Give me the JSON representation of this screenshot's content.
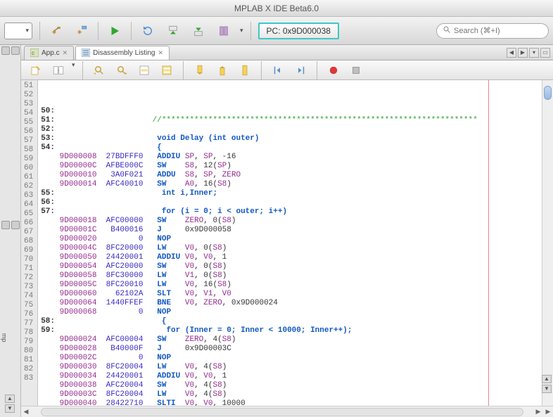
{
  "window": {
    "title": "MPLAB X IDE Beta6.0"
  },
  "toolbar": {
    "pc": "PC: 0x9D000038",
    "searchPlaceholder": "Search (⌘+I)"
  },
  "tabs": [
    {
      "label": "App.c",
      "active": false
    },
    {
      "label": "Disassembly Listing",
      "active": true
    }
  ],
  "disassembly": {
    "startLine": 51,
    "rows": [
      {
        "srcnum": "50:",
        "addr": "",
        "hex": "",
        "code": ""
      },
      {
        "srcnum": "51:",
        "addr": "",
        "hex": "",
        "code": "",
        "comment": "//********************************************************************"
      },
      {
        "srcnum": "52:",
        "addr": "",
        "hex": "",
        "code": ""
      },
      {
        "srcnum": "53:",
        "addr": "",
        "hex": "",
        "src": "void Delay (int outer)"
      },
      {
        "srcnum": "54:",
        "addr": "",
        "hex": "",
        "src": "{"
      },
      {
        "srcnum": "",
        "addr": "9D000008",
        "hex": "27BDFFF0",
        "mnem": "ADDIU",
        "ops": "SP, SP, -16"
      },
      {
        "srcnum": "",
        "addr": "9D00000C",
        "hex": "AFBE000C",
        "mnem": "SW",
        "ops": "S8, 12(SP)"
      },
      {
        "srcnum": "",
        "addr": "9D000010",
        "hex": "3A0F021",
        "mnem": "ADDU",
        "ops": "S8, SP, ZERO"
      },
      {
        "srcnum": "",
        "addr": "9D000014",
        "hex": "AFC40010",
        "mnem": "SW",
        "ops": "A0, 16(S8)"
      },
      {
        "srcnum": "55:",
        "addr": "",
        "hex": "",
        "src": " int i,Inner;"
      },
      {
        "srcnum": "56:",
        "addr": "",
        "hex": "",
        "code": ""
      },
      {
        "srcnum": "57:",
        "addr": "",
        "hex": "",
        "src": " for (i = 0; i < outer; i++)"
      },
      {
        "srcnum": "",
        "addr": "9D000018",
        "hex": "AFC00000",
        "mnem": "SW",
        "ops": "ZERO, 0(S8)"
      },
      {
        "srcnum": "",
        "addr": "9D00001C",
        "hex": "B400016",
        "mnem": "J",
        "ops": "0x9D000058"
      },
      {
        "srcnum": "",
        "addr": "9D000020",
        "hex": "0",
        "mnem": "NOP",
        "ops": ""
      },
      {
        "srcnum": "",
        "addr": "9D00004C",
        "hex": "8FC20000",
        "mnem": "LW",
        "ops": "V0, 0(S8)"
      },
      {
        "srcnum": "",
        "addr": "9D000050",
        "hex": "24420001",
        "mnem": "ADDIU",
        "ops": "V0, V0, 1"
      },
      {
        "srcnum": "",
        "addr": "9D000054",
        "hex": "AFC20000",
        "mnem": "SW",
        "ops": "V0, 0(S8)"
      },
      {
        "srcnum": "",
        "addr": "9D000058",
        "hex": "8FC30000",
        "mnem": "LW",
        "ops": "V1, 0(S8)"
      },
      {
        "srcnum": "",
        "addr": "9D00005C",
        "hex": "8FC20010",
        "mnem": "LW",
        "ops": "V0, 16(S8)"
      },
      {
        "srcnum": "",
        "addr": "9D000060",
        "hex": "62102A",
        "mnem": "SLT",
        "ops": "V0, V1, V0"
      },
      {
        "srcnum": "",
        "addr": "9D000064",
        "hex": "1440FFEF",
        "mnem": "BNE",
        "ops": "V0, ZERO, 0x9D000024"
      },
      {
        "srcnum": "",
        "addr": "9D000068",
        "hex": "0",
        "mnem": "NOP",
        "ops": ""
      },
      {
        "srcnum": "58:",
        "addr": "",
        "hex": "",
        "src": " {"
      },
      {
        "srcnum": "59:",
        "addr": "",
        "hex": "",
        "src": "  for (Inner = 0; Inner < 10000; Inner++);"
      },
      {
        "srcnum": "",
        "addr": "9D000024",
        "hex": "AFC00004",
        "mnem": "SW",
        "ops": "ZERO, 4(S8)"
      },
      {
        "srcnum": "",
        "addr": "9D000028",
        "hex": "B40000F",
        "mnem": "J",
        "ops": "0x9D00003C"
      },
      {
        "srcnum": "",
        "addr": "9D00002C",
        "hex": "0",
        "mnem": "NOP",
        "ops": ""
      },
      {
        "srcnum": "",
        "addr": "9D000030",
        "hex": "8FC20004",
        "mnem": "LW",
        "ops": "V0, 4(S8)"
      },
      {
        "srcnum": "",
        "addr": "9D000034",
        "hex": "24420001",
        "mnem": "ADDIU",
        "ops": "V0, V0, 1"
      },
      {
        "srcnum": "",
        "addr": "9D000038",
        "hex": "AFC20004",
        "mnem": "SW",
        "ops": "V0, 4(S8)"
      },
      {
        "srcnum": "",
        "addr": "9D00003C",
        "hex": "8FC20004",
        "mnem": "LW",
        "ops": "V0, 4(S8)"
      },
      {
        "srcnum": "",
        "addr": "9D000040",
        "hex": "28422710",
        "mnem": "SLTI",
        "ops": "V0, V0, 10000"
      }
    ]
  },
  "colors": {
    "accent": "#3fc6c6",
    "address": "#962b8e",
    "mnemonic": "#1158c2",
    "hex": "#3a29c4",
    "comment": "#1a8a1a"
  }
}
